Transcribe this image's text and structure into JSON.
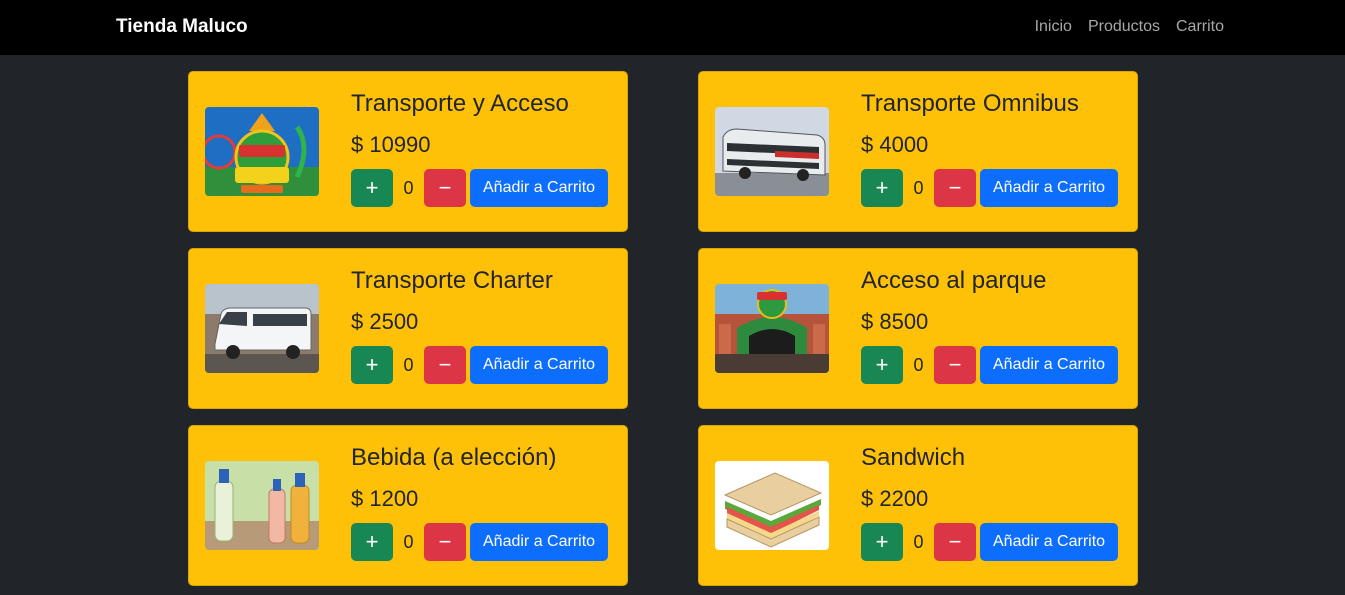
{
  "navbar": {
    "brand": "Tienda Maluco",
    "links": [
      "Inicio",
      "Productos",
      "Carrito"
    ]
  },
  "products": [
    {
      "name": "Transporte y Acceso",
      "price": "$ 10990",
      "qty": "0",
      "image_icon": "parque-de-la-costa-logo-icon"
    },
    {
      "name": "Transporte Omnibus",
      "price": "$ 4000",
      "qty": "0",
      "image_icon": "bus-icon"
    },
    {
      "name": "Transporte Charter",
      "price": "$ 2500",
      "qty": "0",
      "image_icon": "van-icon"
    },
    {
      "name": "Acceso al parque",
      "price": "$ 8500",
      "qty": "0",
      "image_icon": "park-entrance-icon"
    },
    {
      "name": "Bebida (a elección)",
      "price": "$ 1200",
      "qty": "0",
      "image_icon": "bottles-icon"
    },
    {
      "name": "Sandwich",
      "price": "$ 2200",
      "qty": "0",
      "image_icon": "sandwich-icon"
    }
  ],
  "buttons": {
    "plus": "+",
    "minus": "−",
    "add_to_cart": "Añadir a Carrito"
  },
  "colors": {
    "card": "#ffc107",
    "plus": "#198754",
    "minus": "#dc3545",
    "add": "#0d6efd",
    "background": "#212529",
    "navbar": "#000000"
  }
}
